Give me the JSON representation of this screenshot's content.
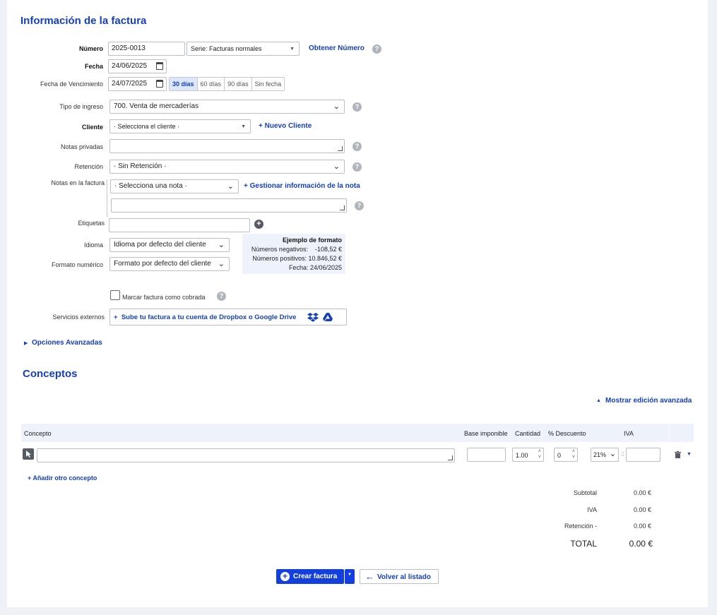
{
  "info": {
    "title": "Información de la factura",
    "numero_label": "Número",
    "numero_value": "2025-0013",
    "serie_value": "Serie: Facturas normales",
    "obtener_numero": "Obtener Número",
    "fecha_label": "Fecha",
    "fecha_value": "24/06/2025",
    "vencimiento_label": "Fecha de Vencimiento",
    "vencimiento_value": "24/07/2025",
    "venc_options": [
      "30 días",
      "60 días",
      "90 días",
      "Sin fecha"
    ],
    "tipo_ingreso_label": "Tipo de ingreso",
    "tipo_ingreso_value": "700. Venta de mercaderías",
    "cliente_label": "Cliente",
    "cliente_value": "· Selecciona el cliente ·",
    "nuevo_cliente": "+ Nuevo Cliente",
    "notas_privadas_label": "Notas privadas",
    "retencion_label": "Retención",
    "retencion_value": "· Sin Retención ·",
    "notas_factura_label": "Notas en la factura",
    "nota_select_value": "· Selecciona una nota ·",
    "gestionar_nota": "+ Gestionar información de la nota",
    "etiquetas_label": "Etiquetas",
    "idioma_label": "Idioma",
    "idioma_value": "Idioma por defecto del cliente",
    "formato_label": "Formato numérico",
    "formato_value": "Formato por defecto del cliente",
    "ejemplo_title": "Ejemplo de formato",
    "ejemplo_neg": "Números negativos:    -108,52 €",
    "ejemplo_pos": "Números positivos: 10.846,52 €",
    "ejemplo_fecha": "Fecha: 24/06/2025",
    "cobrada_label": "Marcar factura como cobrada",
    "servicios_label": "Servicios externos",
    "servicios_button": "+  Sube tu factura a tu cuenta de Dropbox o Google Drive",
    "opciones_avanzadas": "Opciones Avanzadas"
  },
  "conceptos": {
    "title": "Conceptos",
    "mostrar_edicion": "Mostrar edición avanzada",
    "columns": {
      "concepto": "Concepto",
      "base": "Base imponible",
      "cantidad": "Cantidad",
      "descuento": "% Descuento",
      "iva": "IVA"
    },
    "row": {
      "cantidad": "1.00",
      "descuento": "0",
      "iva": "21%"
    },
    "anadir": "+ Añadir otro concepto",
    "totals": {
      "subtotal_label": "Subtotal",
      "subtotal_value": "0.00 €",
      "iva_label": "IVA",
      "iva_value": "0.00 €",
      "retencion_label": "Retención -",
      "retencion_value": "0.00 €",
      "total_label": "TOTAL",
      "total_value": "0.00 €"
    }
  },
  "actions": {
    "crear": "Crear factura",
    "volver": "Volver al listado"
  },
  "colors": {
    "accent": "#1540b8",
    "primary_button": "#1340dd",
    "header_bg": "#eef3fb"
  }
}
